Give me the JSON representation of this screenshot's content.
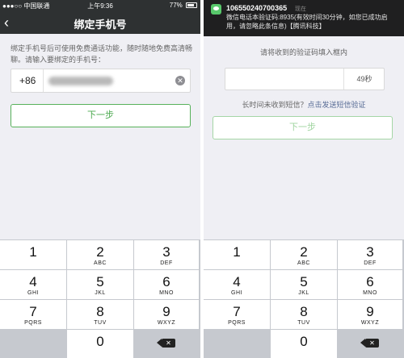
{
  "left": {
    "status": {
      "carrier": "●●●○○ 中国联通",
      "time": "上午9:36",
      "battery": "77%"
    },
    "nav": {
      "back": "‹",
      "title": "绑定手机号"
    },
    "description": "绑定手机号后可使用免费通话功能，随时随地免费高清畅聊。请输入要绑定的手机号：",
    "country_code": "+86",
    "phone_value": "186-3335-3445",
    "clear": "✕",
    "next_label": "下一步"
  },
  "right": {
    "notification": {
      "sender": "106550240700365",
      "time": "现在",
      "body": "微信电话本验证码:8935(有效时间30分钟，如您已成功启用，请忽略此条信息)【腾讯科技】"
    },
    "hint": "请将收到的验证码填入框内",
    "code_value": "",
    "countdown": "49秒",
    "resend_prefix": "长时间未收到短信？",
    "resend_link": "点击发送短信验证",
    "next_label": "下一步"
  },
  "keypad": {
    "keys": [
      {
        "num": "1",
        "sub": ""
      },
      {
        "num": "2",
        "sub": "ABC"
      },
      {
        "num": "3",
        "sub": "DEF"
      },
      {
        "num": "4",
        "sub": "GHI"
      },
      {
        "num": "5",
        "sub": "JKL"
      },
      {
        "num": "6",
        "sub": "MNO"
      },
      {
        "num": "7",
        "sub": "PQRS"
      },
      {
        "num": "8",
        "sub": "TUV"
      },
      {
        "num": "9",
        "sub": "WXYZ"
      },
      {
        "num": "",
        "sub": ""
      },
      {
        "num": "0",
        "sub": ""
      },
      {
        "num": "delete",
        "sub": ""
      }
    ],
    "delete_glyph": "✕"
  }
}
